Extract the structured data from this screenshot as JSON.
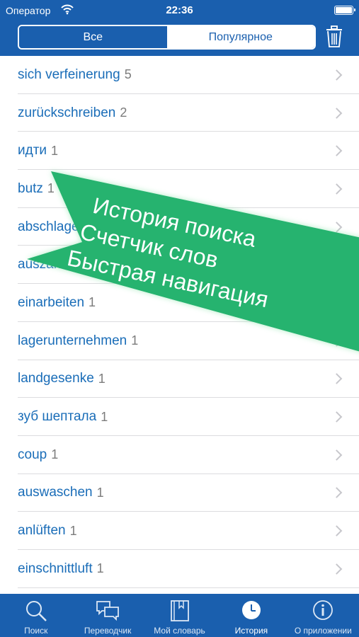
{
  "status_bar": {
    "carrier": "Оператор",
    "time": "22:36"
  },
  "segmented": {
    "all_label": "Все",
    "popular_label": "Популярное",
    "selected": "popular"
  },
  "history": [
    {
      "word": "sich verfeinerung",
      "count": "5"
    },
    {
      "word": "zurückschreiben",
      "count": "2"
    },
    {
      "word": "идти ",
      "count": "1"
    },
    {
      "word": "butz",
      "count": "1"
    },
    {
      "word": "abschlagen",
      "count": "1"
    },
    {
      "word": "auszahlen",
      "count": "1"
    },
    {
      "word": "einarbeiten",
      "count": "1"
    },
    {
      "word": "lagerunternehmen",
      "count": "1"
    },
    {
      "word": "landgesenke",
      "count": "1"
    },
    {
      "word": "зуб шептала",
      "count": "1"
    },
    {
      "word": "coup",
      "count": "1"
    },
    {
      "word": "auswaschen",
      "count": "1"
    },
    {
      "word": "anlüften",
      "count": "1"
    },
    {
      "word": "einschnittluft",
      "count": "1"
    }
  ],
  "banner": {
    "line1": "История поиска",
    "line2": "Счетчик слов",
    "line3": "Быстрая навигация",
    "color": "#26b36f"
  },
  "tabbar": {
    "tabs": [
      {
        "label": "Поиск",
        "icon": "search-icon"
      },
      {
        "label": "Переводчик",
        "icon": "speech-bubbles-icon"
      },
      {
        "label": "Мой словарь",
        "icon": "book-icon"
      },
      {
        "label": "История",
        "icon": "clock-icon"
      },
      {
        "label": "О приложении",
        "icon": "info-icon"
      }
    ],
    "active": "История"
  },
  "colors": {
    "header": "#1a5fae",
    "word": "#1a6db8",
    "count": "#7c7c7c"
  }
}
